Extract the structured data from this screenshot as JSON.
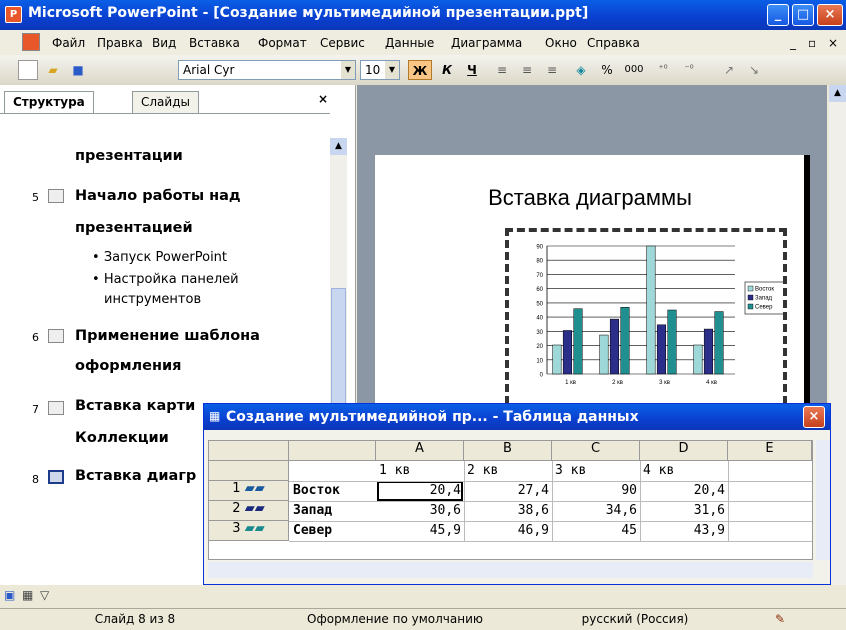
{
  "window": {
    "title": "Microsoft PowerPoint - [Создание мультимедийной презентации.ppt]"
  },
  "menu": [
    "Файл",
    "Правка",
    "Вид",
    "Вставка",
    "Формат",
    "Сервис",
    "Данные",
    "Диаграмма",
    "Окно",
    "Справка"
  ],
  "toolbar": {
    "font": "Arial Cyr",
    "size": "10",
    "bold": "Ж",
    "italic": "К",
    "underline": "Ч",
    "percent": "%",
    "thousands": "000"
  },
  "outline": {
    "tabs": [
      "Структура",
      "Слайды"
    ],
    "items": [
      {
        "text": "презентации"
      },
      {
        "num": "5",
        "lines": [
          "Начало работы над",
          "презентацией"
        ],
        "bullets": [
          "Запуск PowerPoint",
          "Настройка панелей",
          "инструментов"
        ]
      },
      {
        "num": "6",
        "lines": [
          "Применение шаблона",
          "оформления"
        ]
      },
      {
        "num": "7",
        "lines": [
          "Вставка карти",
          "Коллекции"
        ]
      },
      {
        "num": "8",
        "lines": [
          "Вставка диагр"
        ]
      }
    ]
  },
  "slide": {
    "title": "Вставка диаграммы"
  },
  "chart_data": {
    "type": "bar",
    "categories": [
      "1 кв",
      "2 кв",
      "3 кв",
      "4 кв"
    ],
    "series": [
      {
        "name": "Восток",
        "values": [
          20.4,
          27.4,
          90,
          20.4
        ],
        "color": "#9fd8d8"
      },
      {
        "name": "Запад",
        "values": [
          30.6,
          38.6,
          34.6,
          31.6
        ],
        "color": "#2c2f8a"
      },
      {
        "name": "Север",
        "values": [
          45.9,
          46.9,
          45,
          43.9
        ],
        "color": "#1f8f8f"
      }
    ],
    "ylim": [
      0,
      90
    ],
    "yticks": [
      0,
      10,
      20,
      30,
      40,
      50,
      60,
      70,
      80,
      90
    ],
    "legend": "right",
    "grid": true
  },
  "datasheet": {
    "title": "Создание мультимедийной пр... - Таблица данных",
    "columns": [
      "A",
      "B",
      "C",
      "D",
      "E"
    ],
    "header_row": [
      "1 кв",
      "2 кв",
      "3 кв",
      "4 кв"
    ],
    "rows": [
      {
        "num": "1",
        "name": "Восток",
        "values": [
          "20,4",
          "27,4",
          "90",
          "20,4"
        ]
      },
      {
        "num": "2",
        "name": "Запад",
        "values": [
          "30,6",
          "38,6",
          "34,6",
          "31,6"
        ]
      },
      {
        "num": "3",
        "name": "Север",
        "values": [
          "45,9",
          "46,9",
          "45",
          "43,9"
        ]
      }
    ]
  },
  "status": {
    "slide": "Слайд 8 из 8",
    "design": "Оформление по умолчанию",
    "lang": "русский (Россия)"
  }
}
